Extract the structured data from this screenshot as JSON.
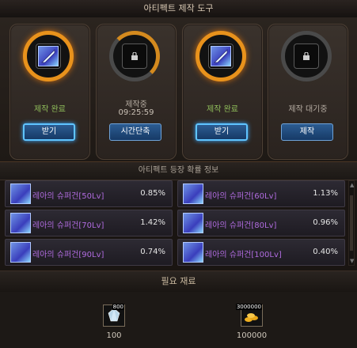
{
  "window": {
    "title": "아티펙트 제작 도구"
  },
  "slots": [
    {
      "state": "done",
      "status": "제작 완료",
      "time": "",
      "button": "받기",
      "icon": "sword-icon",
      "ring_progress": 1.0
    },
    {
      "state": "progress",
      "status": "제작중",
      "time": "09:25:59",
      "button": "시간단축",
      "icon": "lock-icon",
      "ring_progress": 0.5
    },
    {
      "state": "done",
      "status": "제작 완료",
      "time": "",
      "button": "받기",
      "icon": "sword-icon",
      "ring_progress": 1.0
    },
    {
      "state": "wait",
      "status": "제작 대기중",
      "time": "",
      "button": "제작",
      "icon": "lock-icon",
      "ring_progress": 0
    }
  ],
  "info": {
    "title": "아티펙트 등장 확률 정보",
    "items": [
      {
        "name": "레아의 슈퍼건[50Lv]",
        "rate": "0.85%"
      },
      {
        "name": "레아의 슈퍼건[60Lv]",
        "rate": "1.13%"
      },
      {
        "name": "레아의 슈퍼건[70Lv]",
        "rate": "1.42%"
      },
      {
        "name": "레아의 슈퍼건[80Lv]",
        "rate": "0.96%"
      },
      {
        "name": "레아의 슈퍼건[90Lv]",
        "rate": "0.74%"
      },
      {
        "name": "레아의 슈퍼건[100Lv]",
        "rate": "0.40%"
      }
    ]
  },
  "materials": {
    "title": "필요 재료",
    "items": [
      {
        "icon": "crystal-icon",
        "stack": "800",
        "amount": "100"
      },
      {
        "icon": "gold-icon",
        "stack": "3000000",
        "amount": "100000"
      }
    ]
  },
  "colors": {
    "done_ring": "#e8921c",
    "button_blue": "#2c5c92",
    "item_name_purple": "#b06bdf",
    "status_green": "#8fbd5a"
  }
}
